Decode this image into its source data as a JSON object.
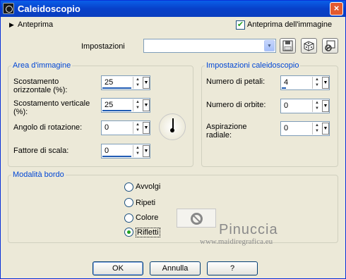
{
  "window": {
    "title": "Caleidoscopio",
    "close_label": "×"
  },
  "preview": {
    "expander_glyph": "▶",
    "label": "Anteprima",
    "image_preview_label": "Anteprima dell'immagine",
    "image_preview_checked": true,
    "check_glyph": "✔"
  },
  "settings": {
    "label": "Impostazioni",
    "value": "",
    "tools": [
      "save-icon",
      "dice-icon",
      "delete-preset-icon"
    ]
  },
  "image_area": {
    "legend": "Area d'immagine",
    "h_offset_label": "Scostamento orizzontale (%):",
    "h_offset_value": "25",
    "v_offset_label": "Scostamento verticale (%):",
    "v_offset_value": "25",
    "rotation_label": "Angolo di rotazione:",
    "rotation_value": "0",
    "scale_label": "Fattore di scala:",
    "scale_value": "0"
  },
  "kaleido": {
    "legend": "Impostazioni caleidoscopio",
    "petals_label": "Numero di petali:",
    "petals_value": "4",
    "orbits_label": "Numero di orbite:",
    "orbits_value": "0",
    "radial_label": "Aspirazione radiale:",
    "radial_value": "0"
  },
  "border_mode": {
    "legend": "Modalità bordo",
    "options": [
      "Avvolgi",
      "Ripeti",
      "Colore",
      "Rifletti"
    ],
    "selected": "Rifletti"
  },
  "watermark": {
    "name": "Pinuccia",
    "url": "www.maidiregrafica.eu"
  },
  "buttons": {
    "ok": "OK",
    "cancel": "Annulla",
    "help": "?"
  },
  "spinner_glyphs": {
    "up": "▲",
    "down": "▼",
    "drop": "▼"
  }
}
